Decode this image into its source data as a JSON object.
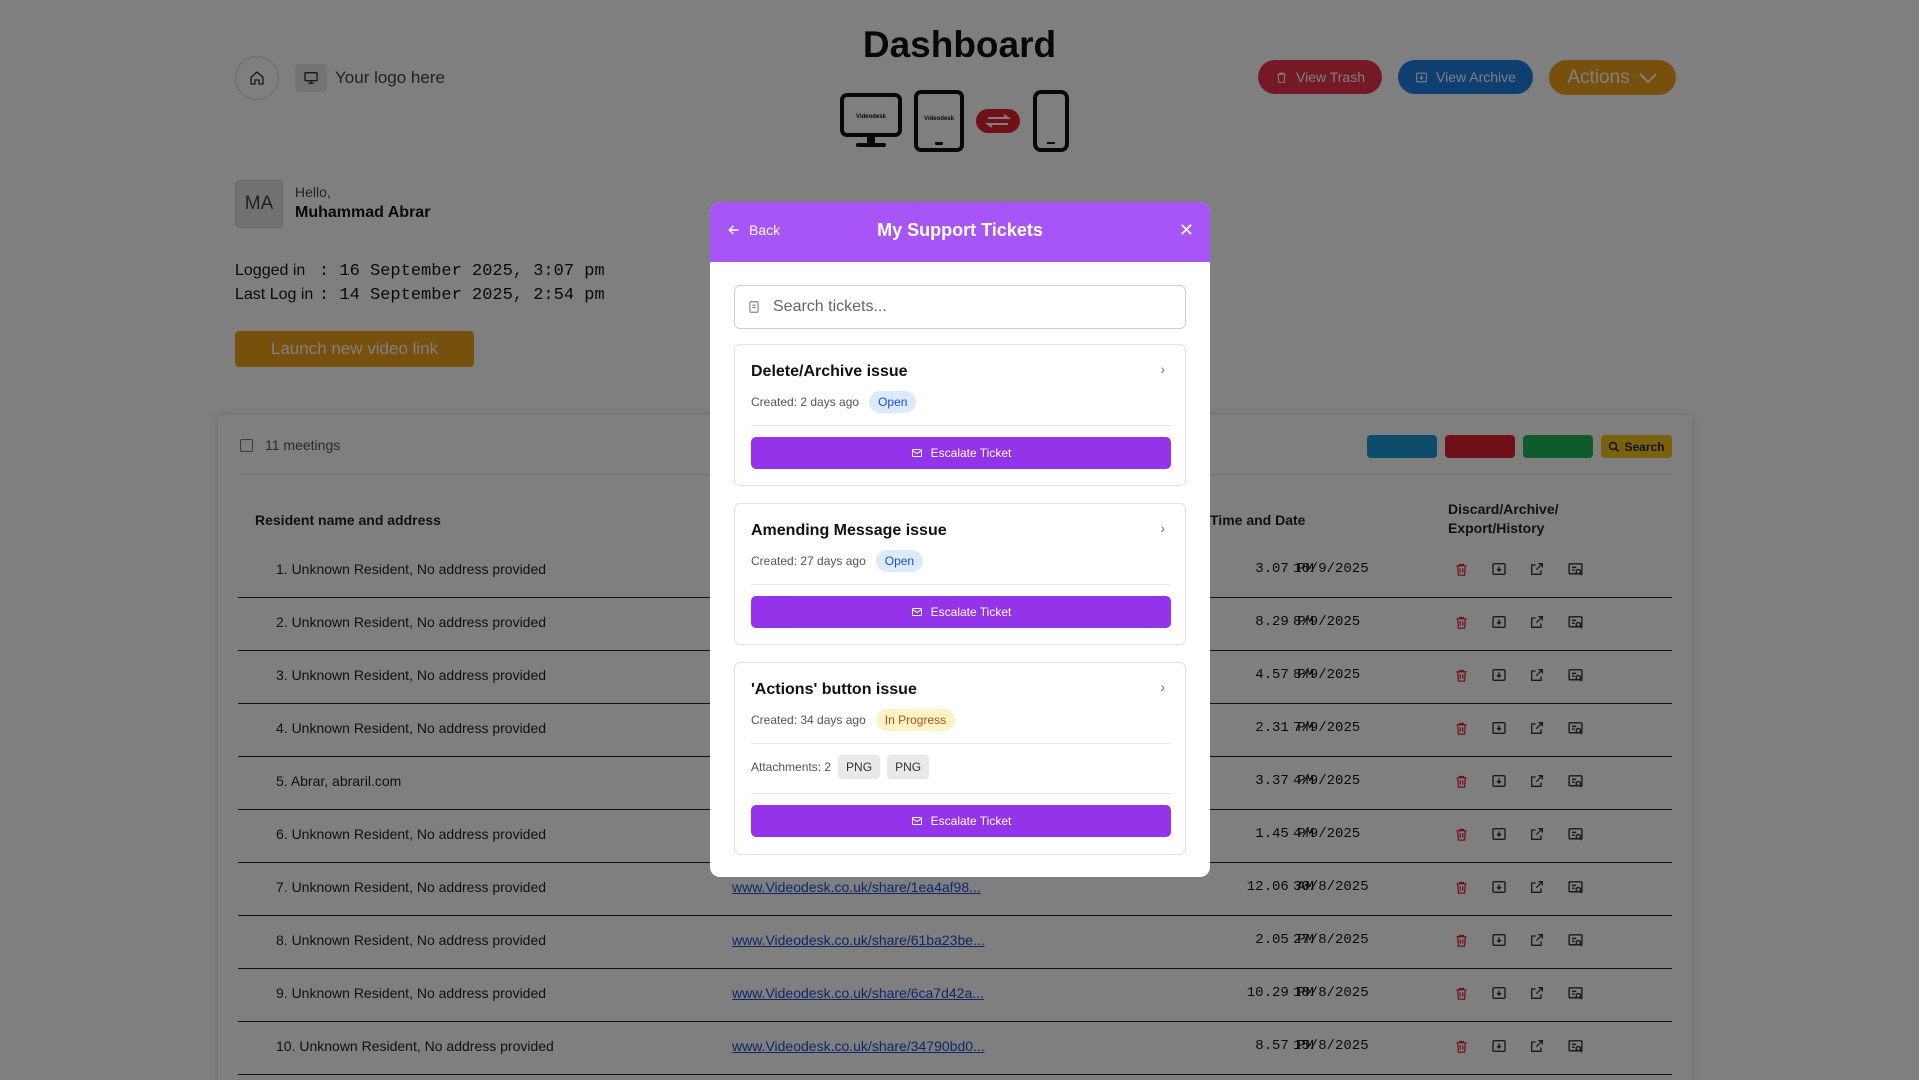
{
  "header": {
    "title": "Dashboard",
    "logo_text": "Your logo here",
    "device_brand": "Videodesk",
    "view_trash_label": "View Trash",
    "view_archive_label": "View Archive",
    "actions_label": "Actions"
  },
  "user": {
    "initials": "MA",
    "greeting": "Hello,",
    "name": "Muhammad Abrar",
    "logged_in_label": "Logged in",
    "logged_in_value": ": 16 September 2025,  3:07 pm",
    "last_login_label": "Last Log in",
    "last_login_value": ": 14 September 2025,  2:54 pm"
  },
  "launch_button_label": "Launch new video link",
  "table": {
    "meetings_count": "11 meetings",
    "search_label": "Search",
    "col_name": "Resident name and address",
    "col_time": "Time and Date",
    "col_actions_line1": "Discard/Archive/",
    "col_actions_line2": "Export/History",
    "rows": [
      {
        "name": "1.  Unknown Resident, No address provided",
        "link": "",
        "time": "3.07 PM",
        "date": "16/9/2025"
      },
      {
        "name": "2.  Unknown Resident, No address provided",
        "link": "",
        "time": "8.29 PM",
        "date": "8/9/2025"
      },
      {
        "name": "3.  Unknown Resident, No address provided",
        "link": "",
        "time": "4.57 PM",
        "date": "8/9/2025"
      },
      {
        "name": "4.  Unknown Resident, No address provided",
        "link": "",
        "time": "2.31 PM",
        "date": "7/9/2025"
      },
      {
        "name": "5.  Abrar, abraril.com",
        "link": "",
        "time": "3.37 PM",
        "date": "4/9/2025"
      },
      {
        "name": "6.  Unknown Resident, No address provided",
        "link": "",
        "time": "1.45 PM",
        "date": "4/9/2025"
      },
      {
        "name": "7.  Unknown Resident, No address provided",
        "link": "www.Videodesk.co.uk/share/1ea4af98...",
        "time": "12.06 AM",
        "date": "30/8/2025"
      },
      {
        "name": "8.  Unknown Resident, No address provided",
        "link": "www.Videodesk.co.uk/share/61ba23be...",
        "time": "2.05 PM",
        "date": "27/8/2025"
      },
      {
        "name": "9.  Unknown Resident, No address provided",
        "link": "www.Videodesk.co.uk/share/6ca7d42a...",
        "time": "10.29 PM",
        "date": "18/8/2025"
      },
      {
        "name": "10.  Unknown Resident, No address provided",
        "link": "www.Videodesk.co.uk/share/34790bd0...",
        "time": "8.57 PM",
        "date": "15/8/2025"
      }
    ]
  },
  "modal": {
    "back_label": "Back",
    "title": "My Support Tickets",
    "search_placeholder": "Search tickets...",
    "tickets": [
      {
        "title": "Delete/Archive issue",
        "created": "Created: 2 days ago",
        "status": "Open",
        "escalate_label": "Escalate Ticket"
      },
      {
        "title": "Amending Message issue",
        "created": "Created: 27 days ago",
        "status": "Open",
        "escalate_label": "Escalate Ticket"
      },
      {
        "title": "'Actions' button issue",
        "created": "Created: 34 days ago",
        "status": "In Progress",
        "attachments_label": "Attachments: 2",
        "attachments": [
          "PNG",
          "PNG"
        ],
        "escalate_label": "Escalate Ticket"
      }
    ]
  },
  "colors": {
    "modal_header": "#a855f7",
    "escalate": "#9333ea",
    "trash": "#e8334a",
    "archive": "#1f7fe0",
    "actions": "#f0a01a",
    "ctrl_blue": "#1a9ad6",
    "ctrl_red": "#e1232f",
    "ctrl_green": "#1db954",
    "ctrl_yellow": "#f5c518"
  }
}
